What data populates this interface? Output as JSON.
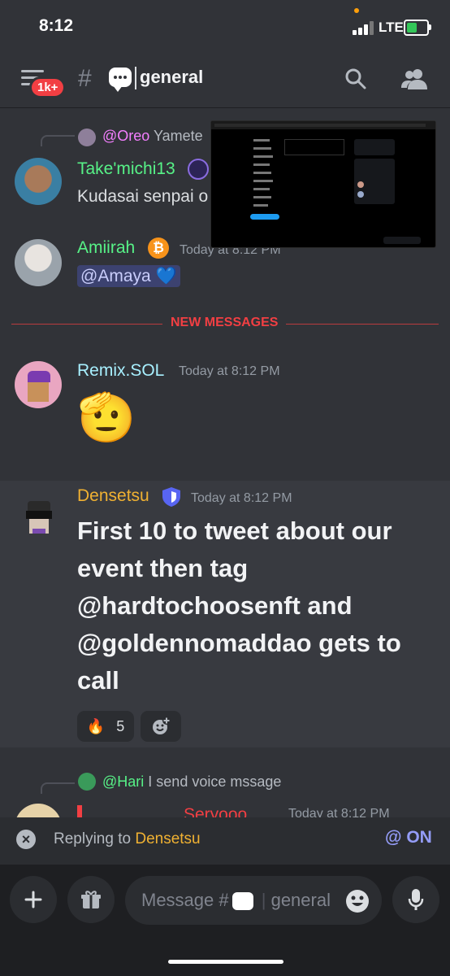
{
  "status": {
    "time": "8:12",
    "network": "LTE"
  },
  "header": {
    "badge": "1k+",
    "channel": "general"
  },
  "messages": {
    "m1": {
      "reply_user": "@Oreo",
      "reply_text": "Yamete",
      "author": "Take'michi13",
      "text": "Kudasai senpai o"
    },
    "m2": {
      "author": "Amiirah",
      "time": "Today at 8:12 PM",
      "mention": "@Amaya 💙"
    },
    "divider": "NEW MESSAGES",
    "m3": {
      "author": "Remix.SOL",
      "time": "Today at 8:12 PM",
      "emoji": "🫡"
    },
    "m4": {
      "author": "Densetsu",
      "time": "Today at 8:12 PM",
      "text": "First 10 to tweet about our event then tag @hardtochoosenft and @goldennomaddao gets to call",
      "reaction_emoji": "🔥",
      "reaction_count": "5"
    },
    "m5": {
      "reply_user": "@Hari",
      "reply_text": "I send voice mssage",
      "author": "Seryooo",
      "time": "Today at 8:12 PM"
    }
  },
  "reply_bar": {
    "prefix": "Replying to",
    "user": "Densetsu",
    "at_label": "@",
    "on_label": "ON"
  },
  "composer": {
    "placeholder_prefix": "Message #",
    "placeholder_channel": "general"
  },
  "colors": {
    "background": "#313338",
    "takemichi": "#57f287",
    "amiirah": "#57f287",
    "remix": "#a8f0ff",
    "densetsu": "#f0b132",
    "oreo": "#f47fff",
    "hari": "#57f287",
    "new_messages": "#f23f43"
  }
}
